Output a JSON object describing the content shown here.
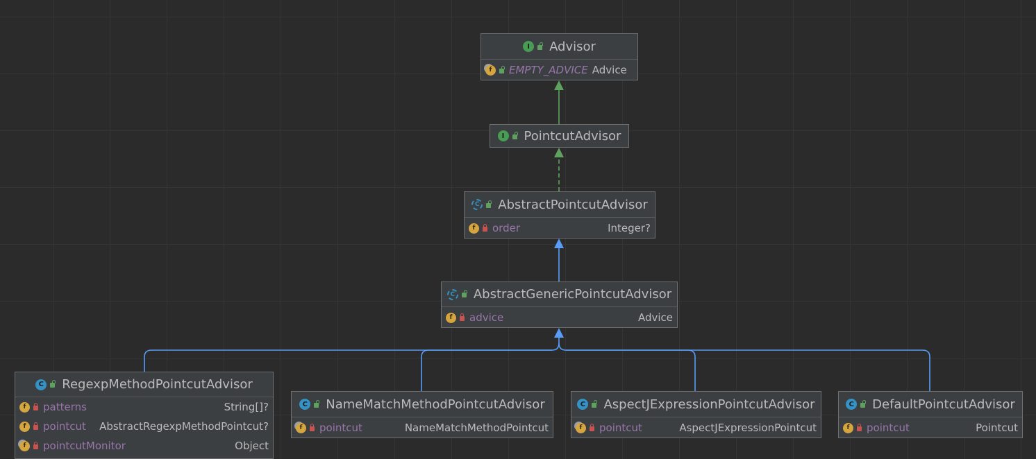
{
  "nodes": {
    "advisor": {
      "kind": "interface",
      "name": "Advisor",
      "fields": [
        {
          "name": "EMPTY_ADVICE",
          "type": "Advice",
          "icon": "static-final-field-icon",
          "access": "public",
          "italic": true
        }
      ]
    },
    "pointcut_advisor": {
      "kind": "interface",
      "name": "PointcutAdvisor",
      "fields": []
    },
    "abstract_pointcut_advisor": {
      "kind": "abstract-class",
      "name": "AbstractPointcutAdvisor",
      "fields": [
        {
          "name": "order",
          "type": "Integer?",
          "icon": "field-icon",
          "access": "private"
        }
      ]
    },
    "abstract_generic_pointcut_advisor": {
      "kind": "abstract-class",
      "name": "AbstractGenericPointcutAdvisor",
      "fields": [
        {
          "name": "advice",
          "type": "Advice",
          "icon": "field-icon",
          "access": "private"
        }
      ]
    },
    "regexp_method_pointcut_advisor": {
      "kind": "class",
      "name": "RegexpMethodPointcutAdvisor",
      "fields": [
        {
          "name": "patterns",
          "type": "String[]?",
          "icon": "field-icon",
          "access": "private"
        },
        {
          "name": "pointcut",
          "type": "AbstractRegexpMethodPointcut?",
          "icon": "field-icon",
          "access": "private"
        },
        {
          "name": "pointcutMonitor",
          "type": "Object",
          "icon": "static-final-field-icon",
          "access": "private"
        }
      ]
    },
    "name_match_method_pointcut_advisor": {
      "kind": "class",
      "name": "NameMatchMethodPointcutAdvisor",
      "fields": [
        {
          "name": "pointcut",
          "type": "NameMatchMethodPointcut",
          "icon": "static-final-field-icon",
          "access": "private"
        }
      ]
    },
    "aspectj_expression_pointcut_advisor": {
      "kind": "class",
      "name": "AspectJExpressionPointcutAdvisor",
      "fields": [
        {
          "name": "pointcut",
          "type": "AspectJExpressionPointcut",
          "icon": "static-final-field-icon",
          "access": "private"
        }
      ]
    },
    "default_pointcut_advisor": {
      "kind": "class",
      "name": "DefaultPointcutAdvisor",
      "fields": [
        {
          "name": "pointcut",
          "type": "Pointcut",
          "icon": "field-icon",
          "access": "private"
        }
      ]
    }
  },
  "relations": [
    {
      "from": "pointcut_advisor",
      "to": "advisor",
      "type": "extends-interface",
      "style": "solid",
      "color": "#5fa25f"
    },
    {
      "from": "abstract_pointcut_advisor",
      "to": "pointcut_advisor",
      "type": "implements",
      "style": "dashed",
      "color": "#5fa25f"
    },
    {
      "from": "abstract_generic_pointcut_advisor",
      "to": "abstract_pointcut_advisor",
      "type": "extends",
      "style": "solid",
      "color": "#589df6"
    },
    {
      "from": "regexp_method_pointcut_advisor",
      "to": "abstract_generic_pointcut_advisor",
      "type": "extends",
      "style": "solid",
      "color": "#589df6"
    },
    {
      "from": "name_match_method_pointcut_advisor",
      "to": "abstract_generic_pointcut_advisor",
      "type": "extends",
      "style": "solid",
      "color": "#589df6"
    },
    {
      "from": "aspectj_expression_pointcut_advisor",
      "to": "abstract_generic_pointcut_advisor",
      "type": "extends",
      "style": "solid",
      "color": "#589df6"
    },
    {
      "from": "default_pointcut_advisor",
      "to": "abstract_generic_pointcut_advisor",
      "type": "extends",
      "style": "solid",
      "color": "#589df6"
    }
  ],
  "icon_glyphs": {
    "interface": "I",
    "class": "C",
    "abstract-class": "C",
    "field": "f"
  },
  "colors": {
    "background": "#2b2b2b",
    "node_fill": "#3c3f41",
    "node_border": "#6f6f6f",
    "text": "#bbbbbb",
    "field_name": "#9876aa",
    "interface_icon": "#499c54",
    "class_icon": "#3592c4",
    "field_icon": "#d5a640",
    "public_lock": "#5fa25f",
    "private_lock": "#c75450",
    "extends_arrow": "#589df6",
    "interface_arrow": "#5fa25f"
  }
}
